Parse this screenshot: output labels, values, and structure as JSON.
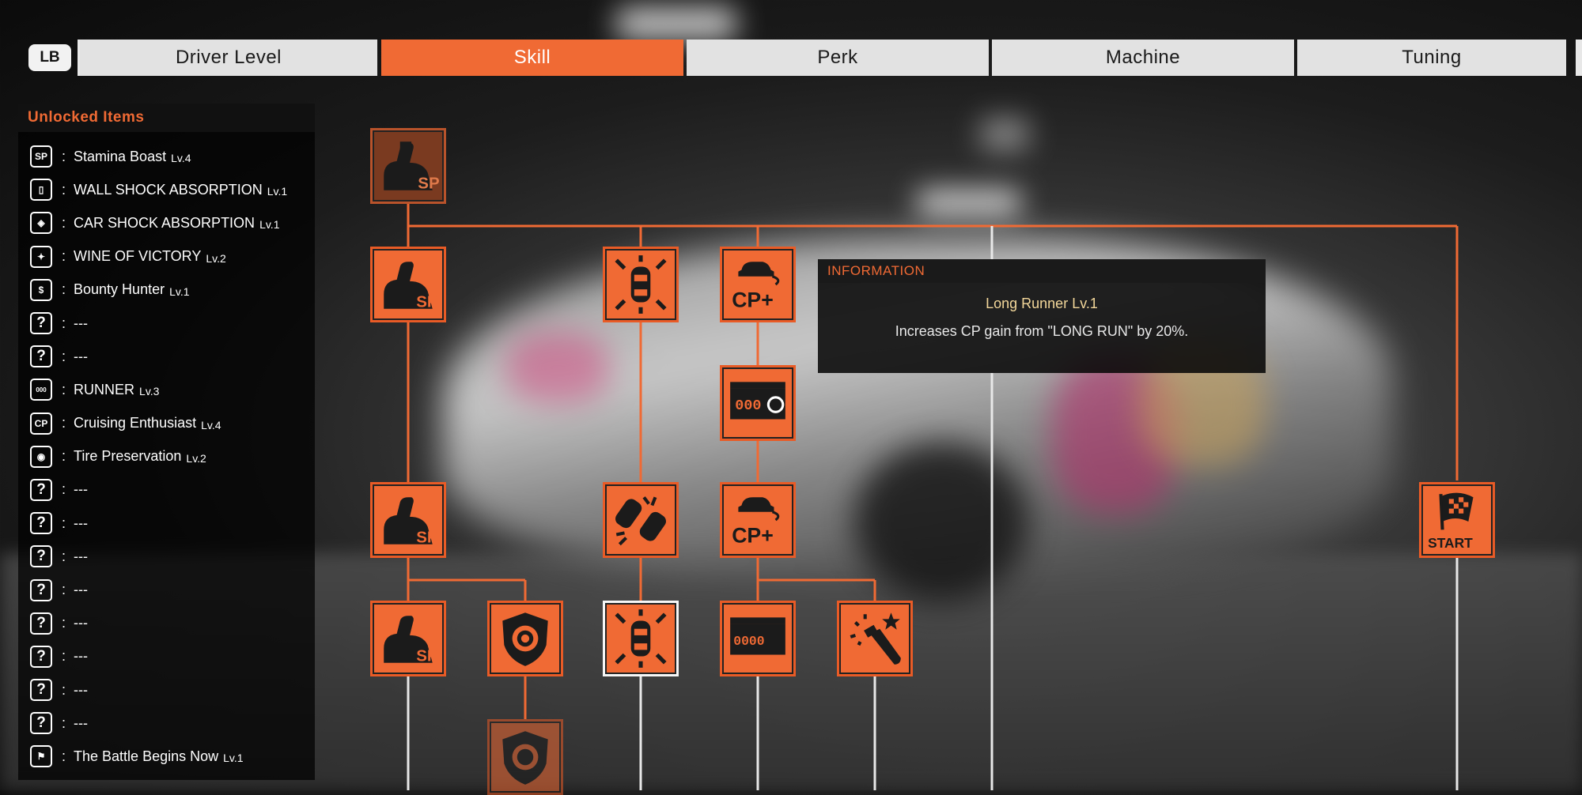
{
  "tabs": {
    "lb_label": "LB",
    "items": [
      {
        "label": "Driver Level",
        "active": false
      },
      {
        "label": "Skill",
        "active": true
      },
      {
        "label": "Perk",
        "active": false
      },
      {
        "label": "Machine",
        "active": false
      },
      {
        "label": "Tuning",
        "active": false
      }
    ]
  },
  "unlocked": {
    "title": "Unlocked Items",
    "items": [
      {
        "icon": "stamina-sp-icon",
        "name": "Stamina Boast",
        "level": "Lv.4"
      },
      {
        "icon": "wall-shock-icon",
        "name": "WALL SHOCK ABSORPTION",
        "level": "Lv.1"
      },
      {
        "icon": "car-shock-icon",
        "name": "CAR SHOCK ABSORPTION",
        "level": "Lv.1"
      },
      {
        "icon": "champagne-icon",
        "name": "WINE OF VICTORY",
        "level": "Lv.2"
      },
      {
        "icon": "bounty-icon",
        "name": "Bounty Hunter",
        "level": "Lv.1"
      },
      {
        "icon": "question-icon",
        "name": "---",
        "level": ""
      },
      {
        "icon": "question-icon",
        "name": "---",
        "level": ""
      },
      {
        "icon": "runner-counter-icon",
        "name": "RUNNER",
        "level": "Lv.3"
      },
      {
        "icon": "cp-plus-icon",
        "name": "Cruising Enthusiast",
        "level": "Lv.4"
      },
      {
        "icon": "tire-shield-icon",
        "name": "Tire Preservation",
        "level": "Lv.2"
      },
      {
        "icon": "question-icon",
        "name": "---",
        "level": ""
      },
      {
        "icon": "question-icon",
        "name": "---",
        "level": ""
      },
      {
        "icon": "question-icon",
        "name": "---",
        "level": ""
      },
      {
        "icon": "question-icon",
        "name": "---",
        "level": ""
      },
      {
        "icon": "question-icon",
        "name": "---",
        "level": ""
      },
      {
        "icon": "question-icon",
        "name": "---",
        "level": ""
      },
      {
        "icon": "question-icon",
        "name": "---",
        "level": ""
      },
      {
        "icon": "question-icon",
        "name": "---",
        "level": ""
      },
      {
        "icon": "start-flag-icon",
        "name": "The Battle Begins Now",
        "level": "Lv.1"
      }
    ]
  },
  "info": {
    "header": "INFORMATION",
    "title": "Long Runner Lv.1",
    "description": "Increases CP gain from \"LONG RUN\" by 20%."
  },
  "tree": {
    "sp_label": "SP",
    "cp_label": "CP+",
    "start_label": "START",
    "counter_digits": "000",
    "counter_digits_long": "0000"
  },
  "colors": {
    "accent": "#f06a34",
    "info_title": "#f3d79a"
  }
}
